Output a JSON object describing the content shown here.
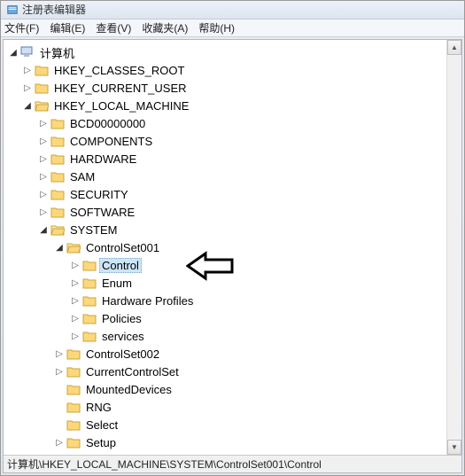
{
  "window": {
    "title": "注册表编辑器"
  },
  "menu": {
    "file": "文件(F)",
    "edit": "编辑(E)",
    "view": "查看(V)",
    "favorites": "收藏夹(A)",
    "help": "帮助(H)"
  },
  "tree": {
    "root": "计算机",
    "hkcr": "HKEY_CLASSES_ROOT",
    "hkcu": "HKEY_CURRENT_USER",
    "hklm": "HKEY_LOCAL_MACHINE",
    "bcd": "BCD00000000",
    "components": "COMPONENTS",
    "hardware": "HARDWARE",
    "sam": "SAM",
    "security": "SECURITY",
    "software": "SOFTWARE",
    "system": "SYSTEM",
    "cs001": "ControlSet001",
    "control": "Control",
    "enum": "Enum",
    "hwprofiles": "Hardware Profiles",
    "policies": "Policies",
    "services": "services",
    "cs002": "ControlSet002",
    "ccs": "CurrentControlSet",
    "mounted": "MountedDevices",
    "rng": "RNG",
    "select": "Select",
    "setup": "Setup"
  },
  "status": {
    "path": "计算机\\HKEY_LOCAL_MACHINE\\SYSTEM\\ControlSet001\\Control"
  }
}
